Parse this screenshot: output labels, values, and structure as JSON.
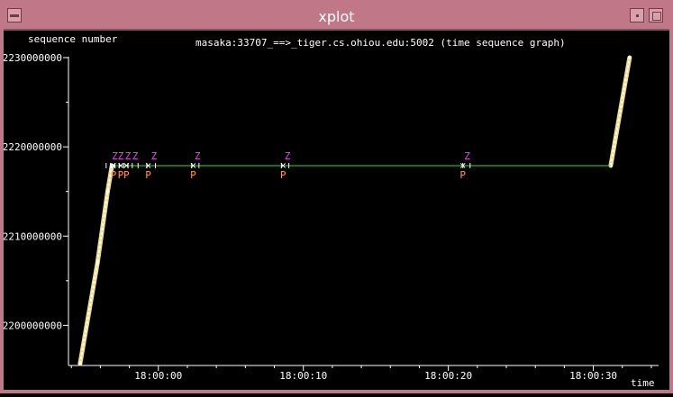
{
  "window": {
    "title": "xplot"
  },
  "chart_data": {
    "type": "scatter",
    "title": "masaka:33707_==>_tiger.cs.ohiou.edu:5002 (time sequence graph)",
    "ylabel": "sequence number",
    "xlabel": "time",
    "y_ticks": [
      {
        "value": 2200000000,
        "label": "2200000000"
      },
      {
        "value": 2210000000,
        "label": "2210000000"
      },
      {
        "value": 2220000000,
        "label": "2220000000"
      },
      {
        "value": 2230000000,
        "label": "2230000000"
      }
    ],
    "x_ticks": [
      {
        "value": 0,
        "label": "18:00:00"
      },
      {
        "value": 10,
        "label": "18:00:10"
      },
      {
        "value": 20,
        "label": "18:00:20"
      },
      {
        "value": 30,
        "label": "18:00:30"
      }
    ],
    "xlim": [
      -6.2,
      34.5
    ],
    "ylim": [
      2195500000,
      2230100000
    ],
    "colors": {
      "data": "#ffffff",
      "data_glow": "#eedd88",
      "window": "#33dd33",
      "zero_window": "#ee44ee",
      "probe": "#ff9944",
      "axis": "#ffffff"
    },
    "series": [
      {
        "name": "data",
        "x": [
          -5.4,
          -4.2,
          -3.5,
          -3.2
        ],
        "y": [
          2195700000,
          2207000000,
          2215000000,
          2217900000
        ]
      },
      {
        "name": "data",
        "x": [
          31.2,
          32.5
        ],
        "y": [
          2217900000,
          2230000000
        ]
      },
      {
        "name": "window",
        "x": [
          -3.2,
          31.2
        ],
        "y": [
          2217900000,
          2217900000
        ]
      }
    ],
    "zero_window_x": [
      -3.0,
      -2.6,
      -2.1,
      -1.6,
      -0.3,
      2.7,
      8.9,
      21.3
    ],
    "probe_x": [
      -3.1,
      -2.6,
      -2.2,
      -0.7,
      2.4,
      8.6,
      21.0
    ],
    "ack_ticks_x": [
      -3.6,
      -3.3,
      -3.0,
      -2.7,
      -2.4,
      -2.1,
      -1.8,
      -1.4,
      -0.8,
      -0.2,
      2.3,
      2.8,
      8.5,
      9.0,
      21.0,
      21.5
    ],
    "marker_labels": {
      "zero_window": "Z",
      "probe": "P"
    }
  }
}
